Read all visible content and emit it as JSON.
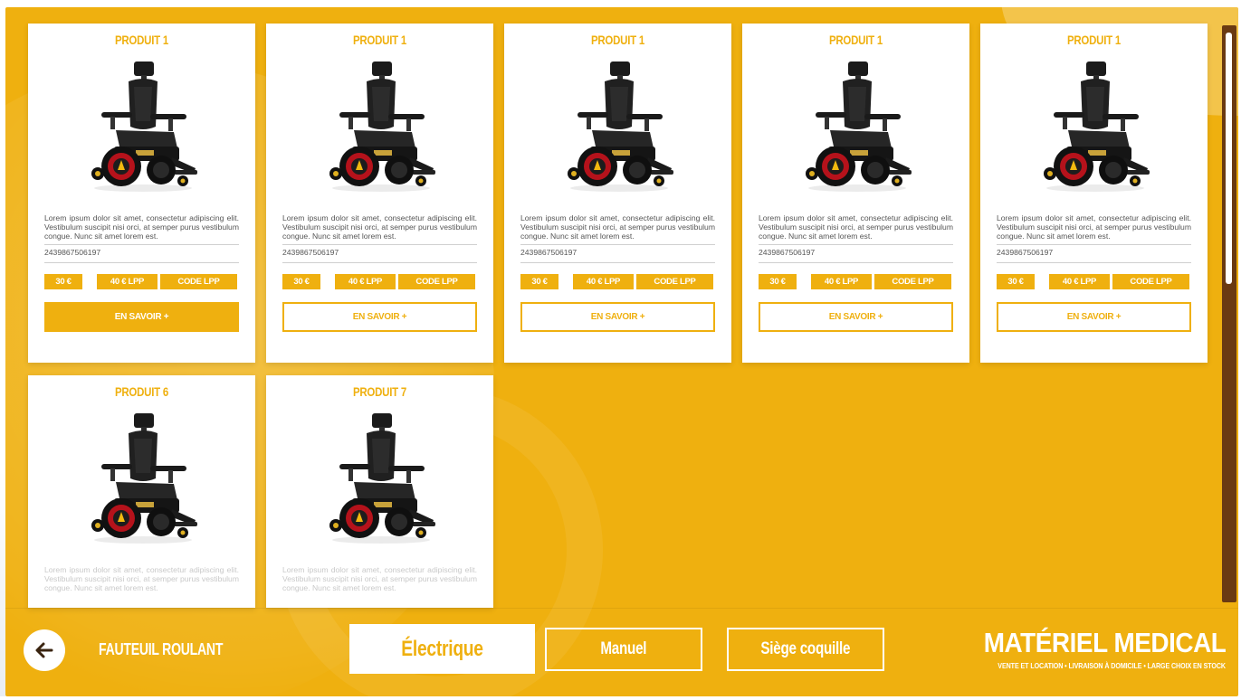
{
  "brand_color": "#efb00f",
  "dark_color": "#6a3a12",
  "products": [
    {
      "title": "PRODUIT 1",
      "description": "Lorem ipsum dolor sit amet, consectetur adipiscing elit. Vestibulum suscipit nisi orci, at semper purus vestibulum congue. Nunc sit amet lorem est.",
      "reference": "2439867506197",
      "price": "30 €",
      "lpp": "40 € LPP",
      "code": "CODE LPP",
      "more": "EN SAVOIR +",
      "more_style": "filled"
    },
    {
      "title": "PRODUIT 1",
      "description": "Lorem ipsum dolor sit amet, consectetur adipiscing elit. Vestibulum suscipit nisi orci, at semper purus vestibulum congue. Nunc sit amet lorem est.",
      "reference": "2439867506197",
      "price": "30 €",
      "lpp": "40 € LPP",
      "code": "CODE LPP",
      "more": "EN SAVOIR +",
      "more_style": "outline"
    },
    {
      "title": "PRODUIT 1",
      "description": "Lorem ipsum dolor sit amet, consectetur adipiscing elit. Vestibulum suscipit nisi orci, at semper purus vestibulum congue. Nunc sit amet lorem est.",
      "reference": "2439867506197",
      "price": "30 €",
      "lpp": "40 € LPP",
      "code": "CODE LPP",
      "more": "EN SAVOIR +",
      "more_style": "outline"
    },
    {
      "title": "PRODUIT 1",
      "description": "Lorem ipsum dolor sit amet, consectetur adipiscing elit. Vestibulum suscipit nisi orci, at semper purus vestibulum congue. Nunc sit amet lorem est.",
      "reference": "2439867506197",
      "price": "30 €",
      "lpp": "40 € LPP",
      "code": "CODE LPP",
      "more": "EN SAVOIR +",
      "more_style": "outline"
    },
    {
      "title": "PRODUIT 1",
      "description": "Lorem ipsum dolor sit amet, consectetur adipiscing elit. Vestibulum suscipit nisi orci, at semper purus vestibulum congue. Nunc sit amet lorem est.",
      "reference": "2439867506197",
      "price": "30 €",
      "lpp": "40 € LPP",
      "code": "CODE LPP",
      "more": "EN SAVOIR +",
      "more_style": "outline"
    },
    {
      "title": "PRODUIT 6",
      "description": "Lorem ipsum dolor sit amet, consectetur adipiscing elit. Vestibulum suscipit nisi orci, at semper purus vestibulum congue. Nunc sit amet lorem est."
    },
    {
      "title": "PRODUIT 7",
      "description": "Lorem ipsum dolor sit amet, consectetur adipiscing elit. Vestibulum suscipit nisi orci, at semper purus vestibulum congue. Nunc sit amet lorem est."
    }
  ],
  "footer": {
    "back_icon": "arrow-left-icon",
    "section_title": "FAUTEUIL ROULANT",
    "tabs": [
      {
        "label": "Électrique",
        "active": true
      },
      {
        "label": "Manuel",
        "active": false
      },
      {
        "label": "Siège coquille",
        "active": false
      }
    ],
    "brand_name": "MATÉRIEL MEDICAL",
    "brand_tagline": "VENTE ET LOCATION  •  LIVRAISON À DOMICILE  •  LARGE CHOIX EN STOCK"
  }
}
